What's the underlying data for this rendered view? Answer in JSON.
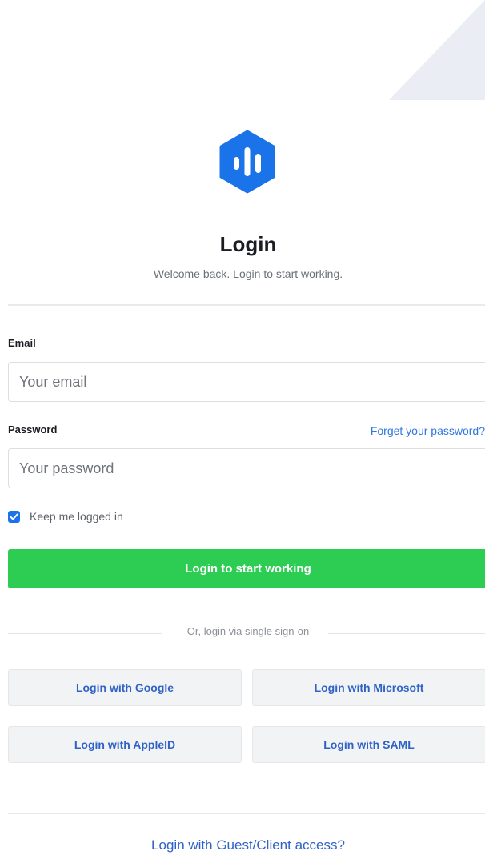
{
  "header": {
    "title": "Login",
    "subtitle": "Welcome back. Login to start working."
  },
  "form": {
    "email": {
      "label": "Email",
      "placeholder": "Your email",
      "value": ""
    },
    "password": {
      "label": "Password",
      "placeholder": "Your password",
      "value": "",
      "forgot_link": "Forget your password?"
    },
    "keep_logged_in": {
      "label": "Keep me logged in",
      "checked": true
    },
    "submit_label": "Login to start working"
  },
  "sso": {
    "divider_text": "Or, login via single sign-on",
    "buttons": [
      {
        "label": "Login with Google"
      },
      {
        "label": "Login with Microsoft"
      },
      {
        "label": "Login with AppleID"
      },
      {
        "label": "Login with SAML"
      }
    ]
  },
  "footer": {
    "guest_link": "Login with Guest/Client access?"
  },
  "colors": {
    "brand_blue": "#1a73e8",
    "primary_green": "#2dcc52",
    "link_blue": "#2f63c6",
    "decor_gray": "#eaedf4"
  },
  "icons": {
    "logo": "hexagon-bars-logo-icon",
    "checkbox": "checkmark-icon"
  }
}
